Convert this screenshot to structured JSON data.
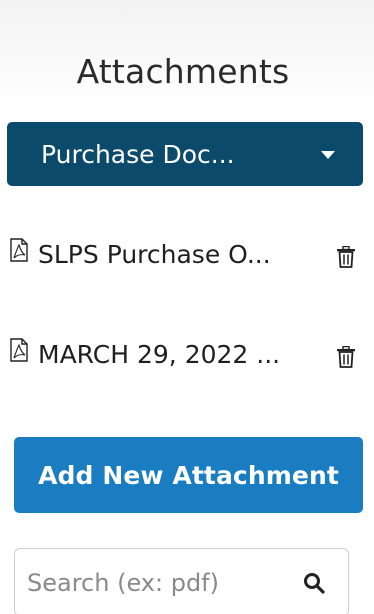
{
  "panel": {
    "title": "Attachments"
  },
  "category_dropdown": {
    "selected": "Purchase Doc...",
    "icon": "caret-down-icon"
  },
  "attachments": [
    {
      "name": "SLPS Purchase O...",
      "icon": "pdf-file-icon",
      "action_icon": "trash-icon"
    },
    {
      "name": "MARCH 29, 2022 ...",
      "icon": "pdf-file-icon",
      "action_icon": "trash-icon"
    }
  ],
  "actions": {
    "add_label": "Add New Attachment"
  },
  "search": {
    "placeholder": "Search (ex: pdf)",
    "value": "",
    "icon": "search-icon"
  },
  "colors": {
    "dropdown_bg": "#0b4a6a",
    "button_bg": "#1a7dc2",
    "text": "#222222"
  }
}
